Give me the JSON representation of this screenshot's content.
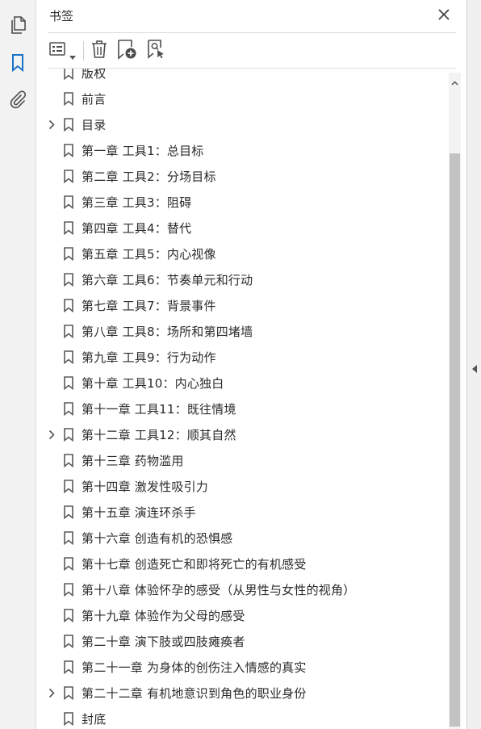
{
  "rail": {
    "items": [
      {
        "name": "page-thumbnails-icon"
      },
      {
        "name": "bookmarks-icon",
        "active": true
      },
      {
        "name": "attachments-icon"
      }
    ]
  },
  "panel": {
    "title": "书签",
    "close_icon": "close-icon",
    "toolbar": {
      "options_icon": "options-menu-icon",
      "delete_icon": "delete-icon",
      "new_bookmark_icon": "new-bookmark-icon",
      "find_bookmark_icon": "find-current-bookmark-icon"
    }
  },
  "bookmarks": [
    {
      "label": "版权",
      "expandable": false
    },
    {
      "label": "前言",
      "expandable": false
    },
    {
      "label": "目录",
      "expandable": true
    },
    {
      "label": "第一章  工具1：总目标",
      "expandable": false
    },
    {
      "label": "第二章  工具2：分场目标",
      "expandable": false
    },
    {
      "label": "第三章  工具3：阻碍",
      "expandable": false
    },
    {
      "label": "第四章  工具4：替代",
      "expandable": false
    },
    {
      "label": "第五章  工具5：内心视像",
      "expandable": false
    },
    {
      "label": "第六章  工具6：节奏单元和行动",
      "expandable": false
    },
    {
      "label": "第七章  工具7：背景事件",
      "expandable": false
    },
    {
      "label": "第八章  工具8：场所和第四堵墙",
      "expandable": false
    },
    {
      "label": "第九章  工具9：行为动作",
      "expandable": false
    },
    {
      "label": "第十章  工具10：内心独白",
      "expandable": false
    },
    {
      "label": "第十一章  工具11：既往情境",
      "expandable": false
    },
    {
      "label": "第十二章  工具12：顺其自然",
      "expandable": true
    },
    {
      "label": "第十三章  药物滥用",
      "expandable": false
    },
    {
      "label": "第十四章  激发性吸引力",
      "expandable": false
    },
    {
      "label": "第十五章  演连环杀手",
      "expandable": false
    },
    {
      "label": "第十六章  创造有机的恐惧感",
      "expandable": false
    },
    {
      "label": "第十七章  创造死亡和即将死亡的有机感受",
      "expandable": false
    },
    {
      "label": "第十八章  体验怀孕的感受（从男性与女性的视角）",
      "expandable": false
    },
    {
      "label": "第十九章  体验作为父母的感受",
      "expandable": false
    },
    {
      "label": "第二十章  演下肢或四肢瘫痪者",
      "expandable": false
    },
    {
      "label": "第二十一章  为身体的创伤注入情感的真实",
      "expandable": false
    },
    {
      "label": "第二十二章  有机地意识到角色的职业身份",
      "expandable": true
    },
    {
      "label": "封底",
      "expandable": false
    }
  ],
  "colors": {
    "accent": "#1a73c8",
    "icon": "#4d4d4d",
    "text": "#2b2b2b"
  }
}
